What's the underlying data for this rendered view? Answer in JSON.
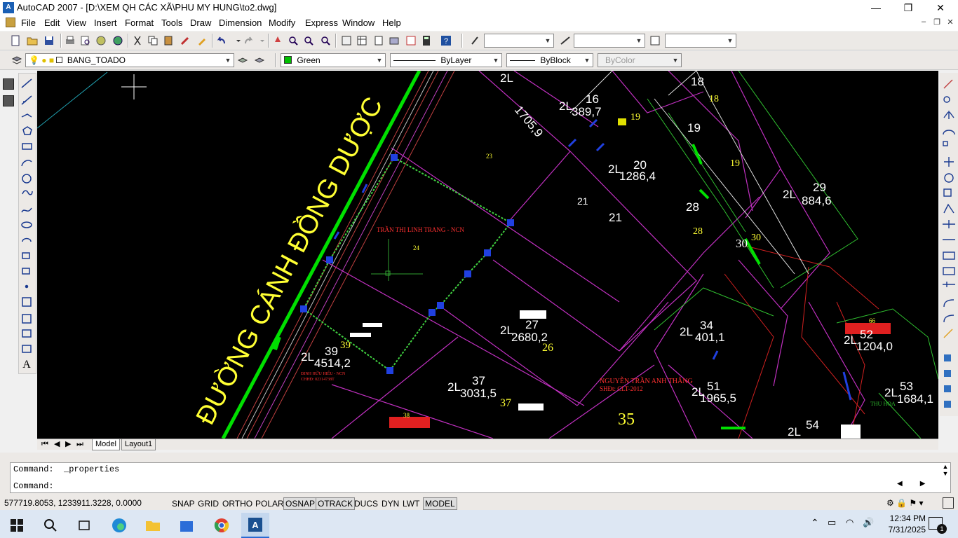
{
  "window": {
    "title": "AutoCAD 2007 - [D:\\XEM QH CÁC XÃ\\PHU MY HUNG\\to2.dwg]",
    "app_icon_text": "A",
    "minimize": "—",
    "restore": "❐",
    "close": "✕"
  },
  "menu": {
    "items": [
      "File",
      "Edit",
      "View",
      "Insert",
      "Format",
      "Tools",
      "Draw",
      "Dimension",
      "Modify",
      "Express",
      "Window",
      "Help"
    ],
    "doc_minimize": "‒",
    "doc_restore": "❐",
    "doc_close": "✕"
  },
  "layers": {
    "current_layer": "BANG_TOADO",
    "color": "Green",
    "linetype": "ByLayer",
    "lineweight": "ByBlock",
    "plotstyle": "ByColor",
    "color_swatch": "#00c000"
  },
  "drawing": {
    "road_label": "ĐƯỜNG CÁNH ĐỒNG DƯỢC",
    "road_color": "#ffff33",
    "labels_white": [
      {
        "t": "18"
      },
      {
        "t": "19"
      },
      {
        "t": "21"
      },
      {
        "t": "21"
      },
      {
        "t": "28"
      },
      {
        "t": "16"
      },
      {
        "t": "389,7"
      },
      {
        "t": "2L"
      },
      {
        "t": "29"
      },
      {
        "t": "884,6"
      },
      {
        "t": "2L"
      },
      {
        "t": "20"
      },
      {
        "t": "1286,4"
      },
      {
        "t": "2L"
      },
      {
        "t": "27"
      },
      {
        "t": "2680,2"
      },
      {
        "t": "2L"
      },
      {
        "t": "39"
      },
      {
        "t": "4514,2"
      },
      {
        "t": "2L"
      },
      {
        "t": "37"
      },
      {
        "t": "3031,5"
      },
      {
        "t": "2L"
      },
      {
        "t": "34"
      },
      {
        "t": "401,1"
      },
      {
        "t": "2L"
      },
      {
        "t": "51"
      },
      {
        "t": "1965,5"
      },
      {
        "t": "2L"
      },
      {
        "t": "52"
      },
      {
        "t": "1204,0"
      },
      {
        "t": "2L"
      },
      {
        "t": "53"
      },
      {
        "t": "1684,1"
      },
      {
        "t": "2L"
      },
      {
        "t": "54"
      },
      {
        "t": "2L"
      },
      {
        "t": "1705,9"
      },
      {
        "t": "2L"
      }
    ],
    "labels_yellow": [
      "18",
      "19",
      "19",
      "28",
      "30",
      "30",
      "26",
      "37",
      "35",
      "39",
      "24",
      "23",
      "38",
      "66"
    ],
    "red_labels": [
      "TRẦN THỊ LINH TRANG - NCN",
      "NGUYỄN TRẦN ANH THẮNG",
      "SHĐt: CLT-2012",
      "ĐINH HỮU HIẾU - NCN",
      "CHHĐ: 02314738T",
      "THU HOA"
    ]
  },
  "layout_tabs": [
    "Model",
    "Layout1"
  ],
  "command": {
    "line1": "Command:  _properties",
    "line2": "Command:"
  },
  "status": {
    "coords": "577719.8053, 1233911.3228, 0.0000",
    "buttons": [
      "SNAP",
      "GRID",
      "ORTHO",
      "POLAR",
      "OSNAP",
      "OTRACK",
      "DUCS",
      "DYN",
      "LWT",
      "MODEL"
    ],
    "on_buttons": [
      "OSNAP",
      "OTRACK",
      "MODEL"
    ]
  },
  "taskbar": {
    "time": "12:34 PM",
    "date": "7/31/2025",
    "notif_count": "1"
  }
}
